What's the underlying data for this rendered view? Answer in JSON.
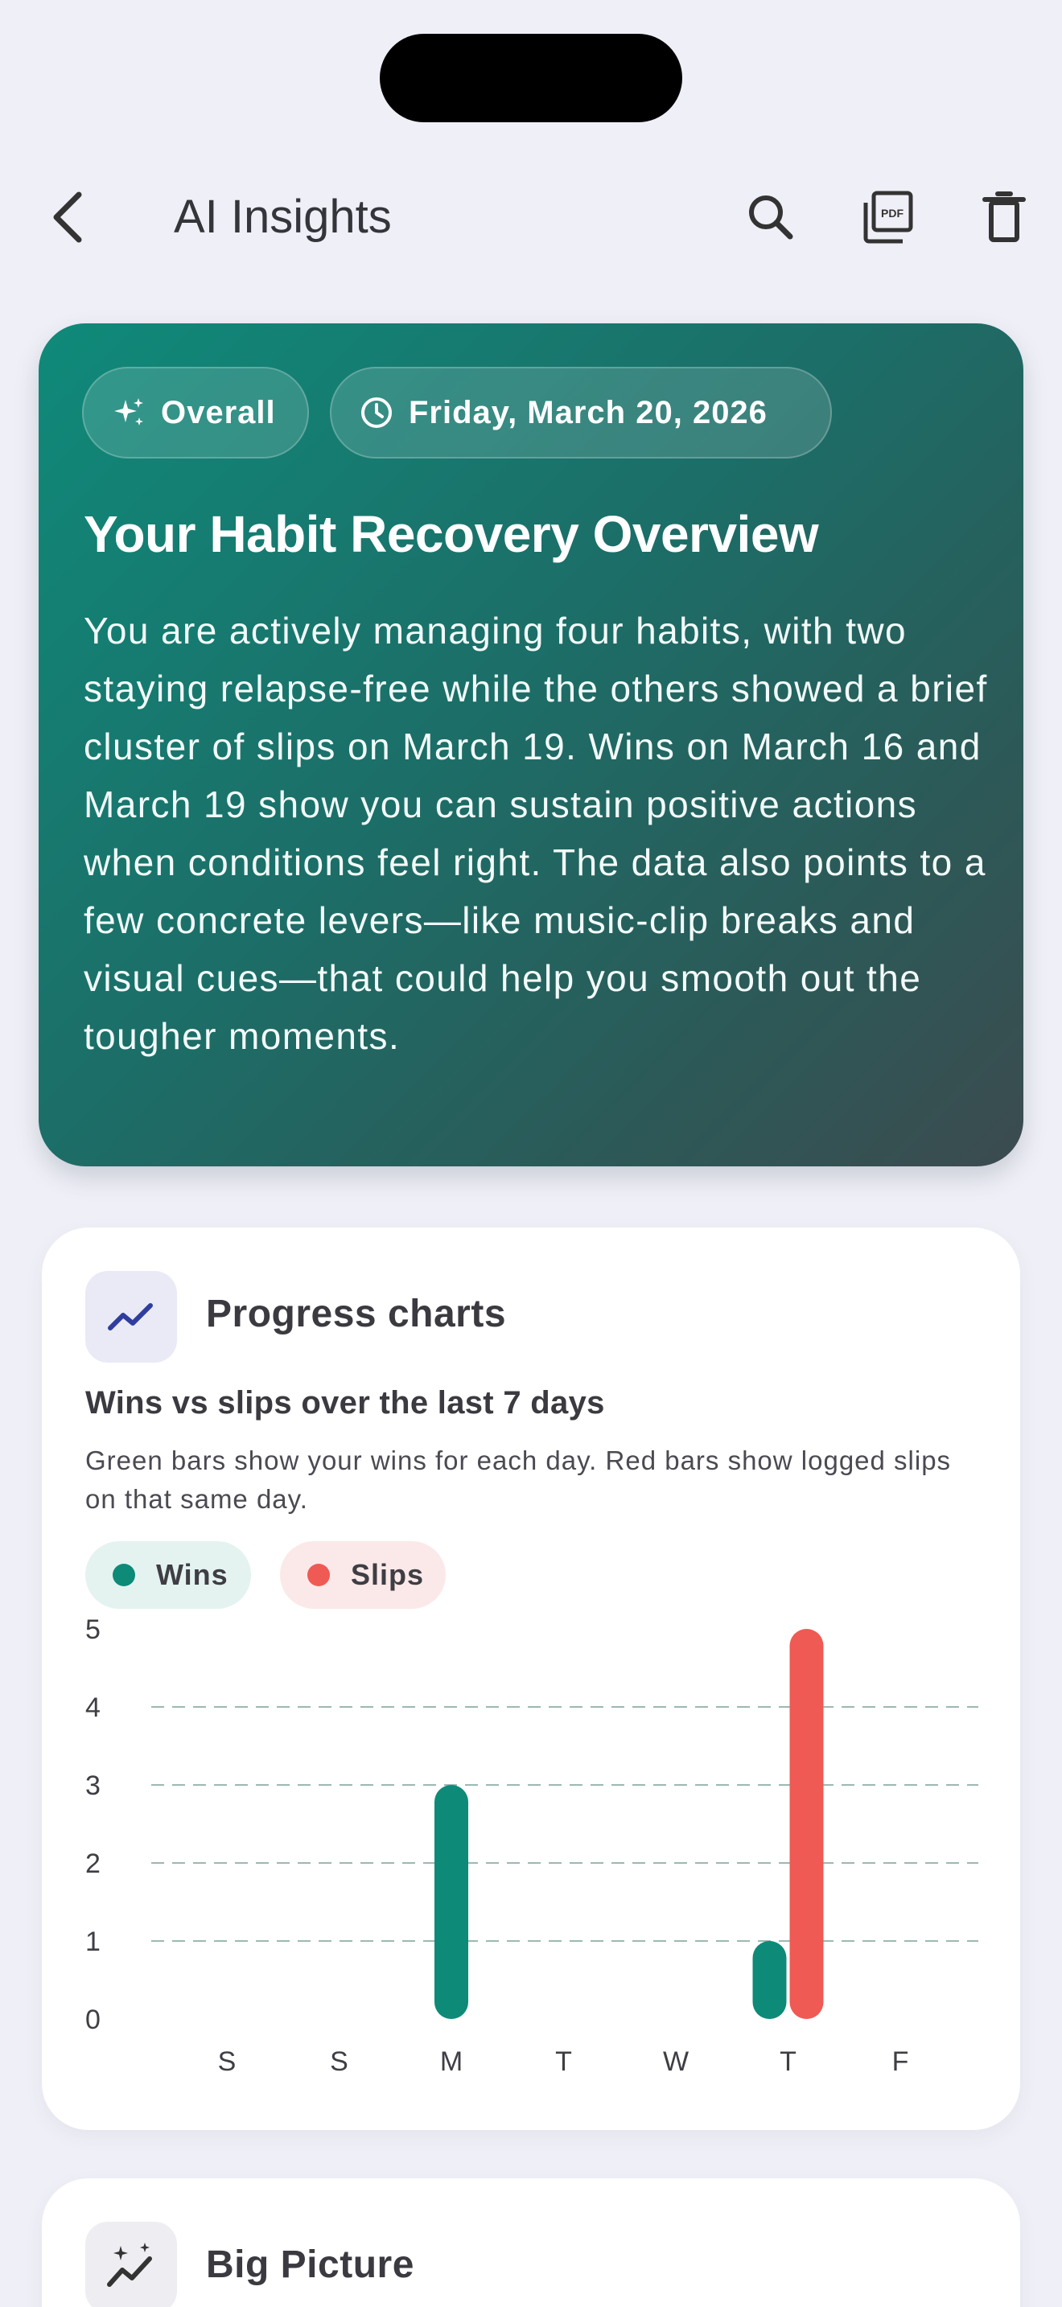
{
  "header": {
    "title": "AI Insights",
    "back_icon": "chevron-left-icon",
    "actions": [
      "search-icon",
      "pdf-icon",
      "trash-icon"
    ]
  },
  "hero": {
    "chips": [
      {
        "icon": "sparkle-icon",
        "label": "Overall"
      },
      {
        "icon": "clock-icon",
        "label": "Friday, March 20, 2026"
      }
    ],
    "title": "Your Habit Recovery Overview",
    "body": "You are actively managing four habits, with two staying relapse-free while the others showed a brief cluster of slips on March 19. Wins on March 16 and March 19 show you can sustain positive actions when conditions feel right. The data also points to a few concrete levers—like music-clip breaks and visual cues—that could help you smooth out the tougher moments."
  },
  "progress_card": {
    "title": "Progress charts",
    "icon": "trend-line-icon",
    "chart_title": "Wins vs slips over the last 7 days",
    "chart_subtitle": "Green bars show your wins for each day. Red bars show logged slips on that same day.",
    "legend": [
      {
        "label": "Wins",
        "color": "#0e8a78"
      },
      {
        "label": "Slips",
        "color": "#ef5a54"
      }
    ]
  },
  "chart_data": {
    "type": "bar",
    "categories": [
      "S",
      "S",
      "M",
      "T",
      "W",
      "T",
      "F"
    ],
    "series": [
      {
        "name": "Wins",
        "color": "#0e8a78",
        "values": [
          0,
          0,
          3,
          0,
          0,
          1,
          0
        ]
      },
      {
        "name": "Slips",
        "color": "#ef5a54",
        "values": [
          0,
          0,
          0,
          0,
          0,
          5,
          0
        ]
      }
    ],
    "yticks": [
      0,
      1,
      2,
      3,
      4,
      5
    ],
    "ylim": [
      0,
      5
    ],
    "grid": true
  },
  "big_picture_card": {
    "title": "Big Picture",
    "icon": "sparkle-trend-icon"
  }
}
